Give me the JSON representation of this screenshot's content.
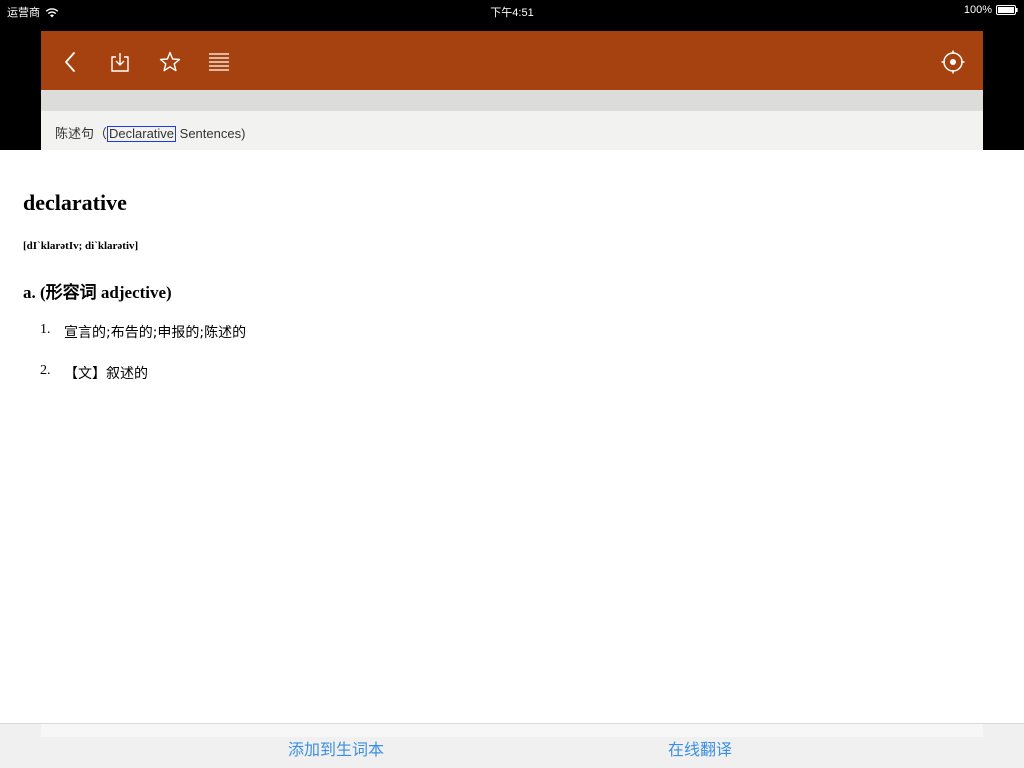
{
  "status_bar": {
    "carrier": "运营商",
    "time": "下午4:51",
    "battery": "100%"
  },
  "toolbar": {
    "icons": [
      "back-icon",
      "download-icon",
      "star-icon",
      "list-icon",
      "target-icon"
    ],
    "accent_color": "#a5420f"
  },
  "page": {
    "sentence_prefix": "陈述句（",
    "highlighted_word": "Declarative",
    "sentence_suffix": " Sentences)"
  },
  "dictionary": {
    "word": "declarative",
    "phonetic": "[dI`klarətIv; di`klarətiv]",
    "part_of_speech": "a. (形容词 adjective)",
    "definitions": [
      {
        "num": "1.",
        "text": "宣言的;布告的;申报的;陈述的"
      },
      {
        "num": "2.",
        "text": "【文】叙述的"
      }
    ]
  },
  "actions": {
    "add_to_wordbook": "添加到生词本",
    "online_translate": "在线翻译",
    "link_color": "#3b8fe0"
  }
}
